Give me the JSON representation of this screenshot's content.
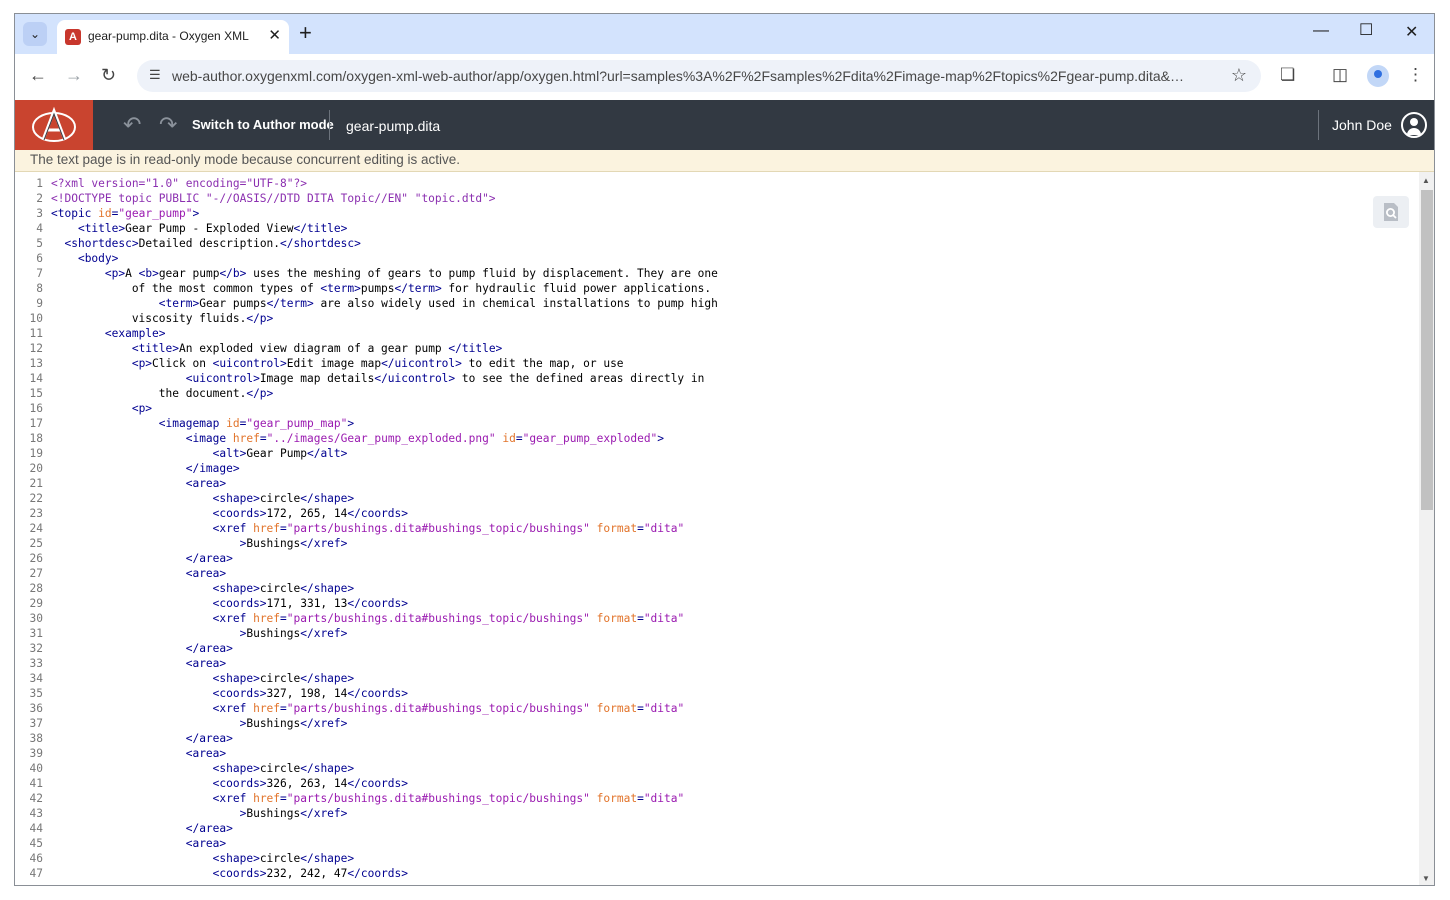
{
  "browser": {
    "tab_title": "gear-pump.dita - Oxygen XML",
    "url": "web-author.oxygenxml.com/oxygen-xml-web-author/app/oxygen.html?url=samples%3A%2F%2Fsamples%2Fdita%2Fimage-map%2Ftopics%2Fgear-pump.dita&ditama..."
  },
  "app": {
    "switch_label": "Switch to Author mode",
    "file_name": "gear-pump.dita",
    "user_name": "John Doe"
  },
  "banner": "The text page is in read-only mode because concurrent editing is active.",
  "editor": {
    "lines": [
      [
        [
          "pi",
          "<?xml version=\"1.0\" encoding=\"UTF-8\"?>"
        ]
      ],
      [
        [
          "pi",
          "<!DOCTYPE topic PUBLIC \"-//OASIS//DTD DITA Topic//EN\" \"topic.dtd\">"
        ]
      ],
      [
        [
          "tag",
          "<topic "
        ],
        [
          "an",
          "id"
        ],
        [
          "tag",
          "="
        ],
        [
          "av",
          "\"gear_pump\""
        ],
        [
          "tag",
          ">"
        ]
      ],
      [
        [
          "tx",
          "    "
        ],
        [
          "tag",
          "<title>"
        ],
        [
          "tx",
          "Gear Pump - Exploded View"
        ],
        [
          "tag",
          "</title>"
        ]
      ],
      [
        [
          "tx",
          "  "
        ],
        [
          "tag",
          "<shortdesc>"
        ],
        [
          "tx",
          "Detailed description."
        ],
        [
          "tag",
          "</shortdesc>"
        ]
      ],
      [
        [
          "tx",
          "    "
        ],
        [
          "tag",
          "<body>"
        ]
      ],
      [
        [
          "tx",
          "        "
        ],
        [
          "tag",
          "<p>"
        ],
        [
          "tx",
          "A "
        ],
        [
          "tag",
          "<b>"
        ],
        [
          "tx",
          "gear pump"
        ],
        [
          "tag",
          "</b>"
        ],
        [
          "tx",
          " uses the meshing of gears to pump fluid by displacement. They are one"
        ]
      ],
      [
        [
          "tx",
          "            of the most common types of "
        ],
        [
          "tag",
          "<term>"
        ],
        [
          "tx",
          "pumps"
        ],
        [
          "tag",
          "</term>"
        ],
        [
          "tx",
          " for hydraulic fluid power applications."
        ]
      ],
      [
        [
          "tx",
          "                "
        ],
        [
          "tag",
          "<term>"
        ],
        [
          "tx",
          "Gear pumps"
        ],
        [
          "tag",
          "</term>"
        ],
        [
          "tx",
          " are also widely used in chemical installations to pump high"
        ]
      ],
      [
        [
          "tx",
          "            viscosity fluids."
        ],
        [
          "tag",
          "</p>"
        ]
      ],
      [
        [
          "tx",
          "        "
        ],
        [
          "tag",
          "<example>"
        ]
      ],
      [
        [
          "tx",
          "            "
        ],
        [
          "tag",
          "<title>"
        ],
        [
          "tx",
          "An exploded view diagram of a gear pump "
        ],
        [
          "tag",
          "</title>"
        ]
      ],
      [
        [
          "tx",
          "            "
        ],
        [
          "tag",
          "<p>"
        ],
        [
          "tx",
          "Click on "
        ],
        [
          "tag",
          "<uicontrol>"
        ],
        [
          "tx",
          "Edit image map"
        ],
        [
          "tag",
          "</uicontrol>"
        ],
        [
          "tx",
          " to edit the map, or use"
        ]
      ],
      [
        [
          "tx",
          "                    "
        ],
        [
          "tag",
          "<uicontrol>"
        ],
        [
          "tx",
          "Image map details"
        ],
        [
          "tag",
          "</uicontrol>"
        ],
        [
          "tx",
          " to see the defined areas directly in"
        ]
      ],
      [
        [
          "tx",
          "                the document."
        ],
        [
          "tag",
          "</p>"
        ]
      ],
      [
        [
          "tx",
          "            "
        ],
        [
          "tag",
          "<p>"
        ]
      ],
      [
        [
          "tx",
          "                "
        ],
        [
          "tag",
          "<imagemap "
        ],
        [
          "an",
          "id"
        ],
        [
          "tag",
          "="
        ],
        [
          "av",
          "\"gear_pump_map\""
        ],
        [
          "tag",
          ">"
        ]
      ],
      [
        [
          "tx",
          "                    "
        ],
        [
          "tag",
          "<image "
        ],
        [
          "an",
          "href"
        ],
        [
          "tag",
          "="
        ],
        [
          "av",
          "\"../images/Gear_pump_exploded.png\""
        ],
        [
          "tx",
          " "
        ],
        [
          "an",
          "id"
        ],
        [
          "tag",
          "="
        ],
        [
          "av",
          "\"gear_pump_exploded\""
        ],
        [
          "tag",
          ">"
        ]
      ],
      [
        [
          "tx",
          "                        "
        ],
        [
          "tag",
          "<alt>"
        ],
        [
          "tx",
          "Gear Pump"
        ],
        [
          "tag",
          "</alt>"
        ]
      ],
      [
        [
          "tx",
          "                    "
        ],
        [
          "tag",
          "</image>"
        ]
      ],
      [
        [
          "tx",
          "                    "
        ],
        [
          "tag",
          "<area>"
        ]
      ],
      [
        [
          "tx",
          "                        "
        ],
        [
          "tag",
          "<shape>"
        ],
        [
          "tx",
          "circle"
        ],
        [
          "tag",
          "</shape>"
        ]
      ],
      [
        [
          "tx",
          "                        "
        ],
        [
          "tag",
          "<coords>"
        ],
        [
          "tx",
          "172, 265, 14"
        ],
        [
          "tag",
          "</coords>"
        ]
      ],
      [
        [
          "tx",
          "                        "
        ],
        [
          "tag",
          "<xref "
        ],
        [
          "an",
          "href"
        ],
        [
          "tag",
          "="
        ],
        [
          "av",
          "\"parts/bushings.dita#bushings_topic/bushings\""
        ],
        [
          "tx",
          " "
        ],
        [
          "an",
          "format"
        ],
        [
          "tag",
          "="
        ],
        [
          "av",
          "\"dita\""
        ]
      ],
      [
        [
          "tx",
          "                            "
        ],
        [
          "tag",
          ">"
        ],
        [
          "tx",
          "Bushings"
        ],
        [
          "tag",
          "</xref>"
        ]
      ],
      [
        [
          "tx",
          "                    "
        ],
        [
          "tag",
          "</area>"
        ]
      ],
      [
        [
          "tx",
          "                    "
        ],
        [
          "tag",
          "<area>"
        ]
      ],
      [
        [
          "tx",
          "                        "
        ],
        [
          "tag",
          "<shape>"
        ],
        [
          "tx",
          "circle"
        ],
        [
          "tag",
          "</shape>"
        ]
      ],
      [
        [
          "tx",
          "                        "
        ],
        [
          "tag",
          "<coords>"
        ],
        [
          "tx",
          "171, 331, 13"
        ],
        [
          "tag",
          "</coords>"
        ]
      ],
      [
        [
          "tx",
          "                        "
        ],
        [
          "tag",
          "<xref "
        ],
        [
          "an",
          "href"
        ],
        [
          "tag",
          "="
        ],
        [
          "av",
          "\"parts/bushings.dita#bushings_topic/bushings\""
        ],
        [
          "tx",
          " "
        ],
        [
          "an",
          "format"
        ],
        [
          "tag",
          "="
        ],
        [
          "av",
          "\"dita\""
        ]
      ],
      [
        [
          "tx",
          "                            "
        ],
        [
          "tag",
          ">"
        ],
        [
          "tx",
          "Bushings"
        ],
        [
          "tag",
          "</xref>"
        ]
      ],
      [
        [
          "tx",
          "                    "
        ],
        [
          "tag",
          "</area>"
        ]
      ],
      [
        [
          "tx",
          "                    "
        ],
        [
          "tag",
          "<area>"
        ]
      ],
      [
        [
          "tx",
          "                        "
        ],
        [
          "tag",
          "<shape>"
        ],
        [
          "tx",
          "circle"
        ],
        [
          "tag",
          "</shape>"
        ]
      ],
      [
        [
          "tx",
          "                        "
        ],
        [
          "tag",
          "<coords>"
        ],
        [
          "tx",
          "327, 198, 14"
        ],
        [
          "tag",
          "</coords>"
        ]
      ],
      [
        [
          "tx",
          "                        "
        ],
        [
          "tag",
          "<xref "
        ],
        [
          "an",
          "href"
        ],
        [
          "tag",
          "="
        ],
        [
          "av",
          "\"parts/bushings.dita#bushings_topic/bushings\""
        ],
        [
          "tx",
          " "
        ],
        [
          "an",
          "format"
        ],
        [
          "tag",
          "="
        ],
        [
          "av",
          "\"dita\""
        ]
      ],
      [
        [
          "tx",
          "                            "
        ],
        [
          "tag",
          ">"
        ],
        [
          "tx",
          "Bushings"
        ],
        [
          "tag",
          "</xref>"
        ]
      ],
      [
        [
          "tx",
          "                    "
        ],
        [
          "tag",
          "</area>"
        ]
      ],
      [
        [
          "tx",
          "                    "
        ],
        [
          "tag",
          "<area>"
        ]
      ],
      [
        [
          "tx",
          "                        "
        ],
        [
          "tag",
          "<shape>"
        ],
        [
          "tx",
          "circle"
        ],
        [
          "tag",
          "</shape>"
        ]
      ],
      [
        [
          "tx",
          "                        "
        ],
        [
          "tag",
          "<coords>"
        ],
        [
          "tx",
          "326, 263, 14"
        ],
        [
          "tag",
          "</coords>"
        ]
      ],
      [
        [
          "tx",
          "                        "
        ],
        [
          "tag",
          "<xref "
        ],
        [
          "an",
          "href"
        ],
        [
          "tag",
          "="
        ],
        [
          "av",
          "\"parts/bushings.dita#bushings_topic/bushings\""
        ],
        [
          "tx",
          " "
        ],
        [
          "an",
          "format"
        ],
        [
          "tag",
          "="
        ],
        [
          "av",
          "\"dita\""
        ]
      ],
      [
        [
          "tx",
          "                            "
        ],
        [
          "tag",
          ">"
        ],
        [
          "tx",
          "Bushings"
        ],
        [
          "tag",
          "</xref>"
        ]
      ],
      [
        [
          "tx",
          "                    "
        ],
        [
          "tag",
          "</area>"
        ]
      ],
      [
        [
          "tx",
          "                    "
        ],
        [
          "tag",
          "<area>"
        ]
      ],
      [
        [
          "tx",
          "                        "
        ],
        [
          "tag",
          "<shape>"
        ],
        [
          "tx",
          "circle"
        ],
        [
          "tag",
          "</shape>"
        ]
      ],
      [
        [
          "tx",
          "                        "
        ],
        [
          "tag",
          "<coords>"
        ],
        [
          "tx",
          "232, 242, 47"
        ],
        [
          "tag",
          "</coords>"
        ]
      ]
    ]
  }
}
